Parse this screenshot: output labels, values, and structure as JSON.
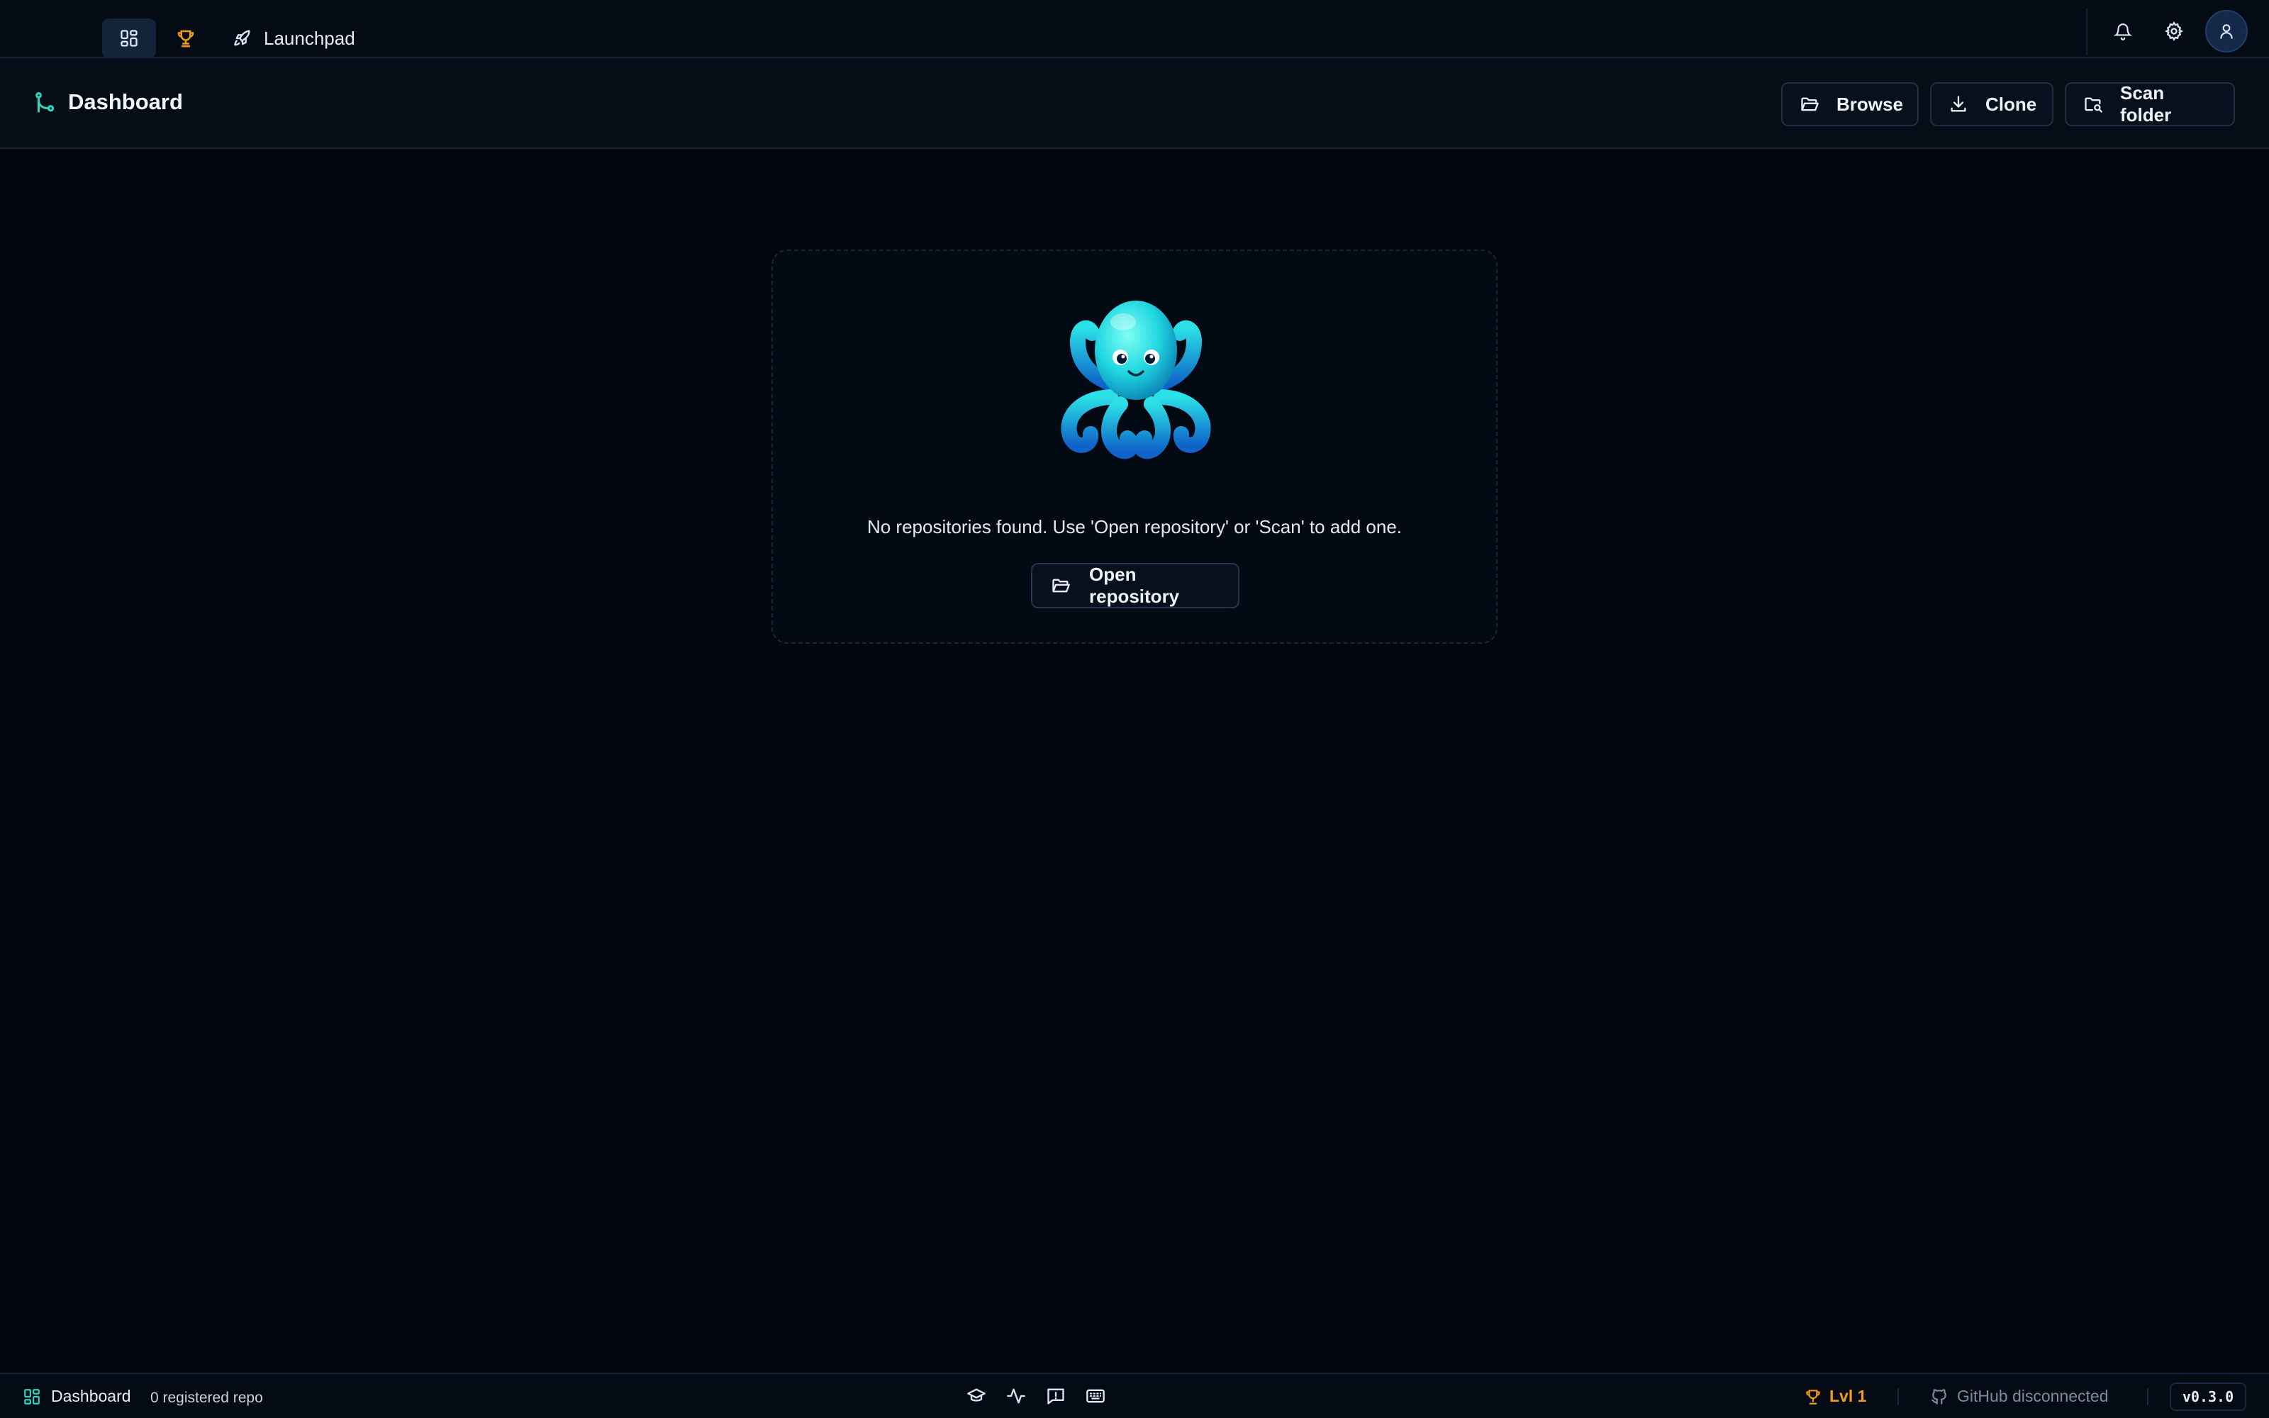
{
  "topbar": {
    "nav": [
      {
        "name": "dashboard",
        "icon": "dashboard-grid-icon",
        "active": true
      },
      {
        "name": "achievements",
        "icon": "trophy-icon",
        "color": "#f29b1b"
      },
      {
        "name": "launchpad",
        "icon": "rocket-icon",
        "label": "Launchpad"
      }
    ],
    "actions": [
      {
        "name": "notifications",
        "icon": "bell-icon"
      },
      {
        "name": "settings",
        "icon": "gear-icon"
      },
      {
        "name": "account",
        "icon": "user-icon"
      }
    ]
  },
  "header": {
    "icon": "git-branch-icon",
    "icon_color": "#2dd4bf",
    "title": "Dashboard",
    "buttons": [
      {
        "icon": "folder-open-icon",
        "label": "Browse"
      },
      {
        "icon": "download-icon",
        "label": "Clone"
      },
      {
        "icon": "folder-search-icon",
        "label": "Scan folder"
      }
    ]
  },
  "empty_state": {
    "illustration": "octopus-mascot",
    "message": "No repositories found. Use 'Open repository' or 'Scan' to add one.",
    "button": {
      "icon": "folder-open-icon",
      "label": "Open repository"
    }
  },
  "statusbar": {
    "view": {
      "icon": "dashboard-grid-icon",
      "label": "Dashboard"
    },
    "repo_count": "0 registered repo",
    "tools": [
      {
        "icon": "graduation-cap-icon"
      },
      {
        "icon": "activity-icon"
      },
      {
        "icon": "feedback-icon"
      },
      {
        "icon": "keyboard-icon"
      }
    ],
    "level": {
      "icon": "trophy-icon",
      "label": "Lvl 1",
      "color": "#f29b1b"
    },
    "github": {
      "icon": "github-icon",
      "label": "GitHub disconnected"
    },
    "version": "v0.3.0"
  },
  "colors": {
    "background": "#02070e",
    "accent_teal": "#2dd4bf",
    "accent_orange": "#f29b1b"
  }
}
